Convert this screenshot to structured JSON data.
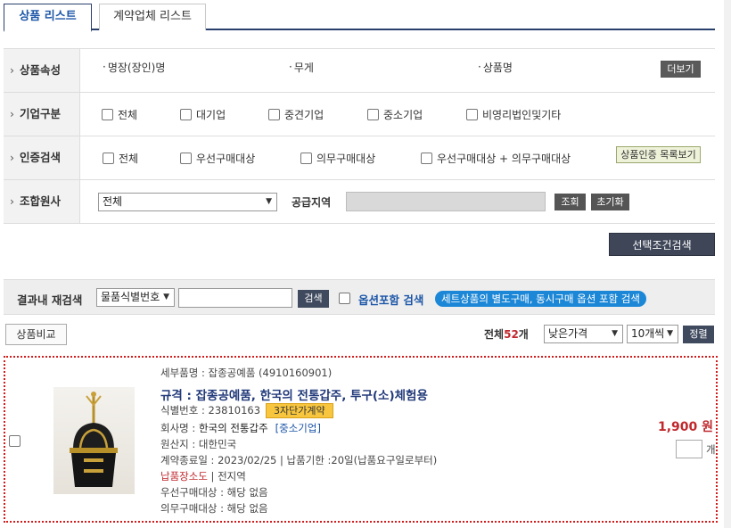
{
  "tabs": [
    {
      "label": "상품 리스트"
    },
    {
      "label": "계약업체 리스트"
    }
  ],
  "filters": {
    "attr": {
      "label": "상품속성",
      "items": [
        "명장(장인)명",
        "무게",
        "상품명"
      ],
      "more_btn": "더보기"
    },
    "company": {
      "label": "기업구분",
      "options": [
        "전체",
        "대기업",
        "중견기업",
        "중소기업",
        "비영리법인및기타"
      ]
    },
    "cert": {
      "label": "인증검색",
      "options": [
        "전체",
        "우선구매대상",
        "의무구매대상",
        "우선구매대상 + 의무구매대상"
      ],
      "list_btn": "상품인증 목록보기"
    },
    "union": {
      "label": "조합원사",
      "select_value": "전체",
      "region_label": "공급지역",
      "search_btn": "조회",
      "reset_btn": "초기화"
    }
  },
  "search_selected_btn": "선택조건검색",
  "research": {
    "label": "결과내 재검색",
    "select_value": "물품식별번호",
    "input_value": "",
    "search_btn": "검색",
    "option_label": "옵션포함 검색",
    "option_note": "세트상품의 별도구매, 동시구매 옵션 포함 검색"
  },
  "list": {
    "compare_btn": "상품비교",
    "total_prefix": "전체",
    "total_count": "52",
    "total_suffix": "개",
    "sort_value": "낮은가격",
    "page_size": "10개씩",
    "sort_btn": "정렬"
  },
  "product": {
    "detail_name": "세부품명 : 잡종공예품 (4910160901)",
    "title": "규격 : 잡종공예품, 한국의 전통갑주, 투구(소)체험용",
    "id_label": "식별번호 : 23810163",
    "badge": "3자단가계약",
    "company_label": "회사명 : ",
    "company_name": "한국의 전통갑주",
    "company_type": "[중소기업]",
    "origin": "원산지 : 대한민국",
    "contract": "계약종료일 : 2023/02/25 | 납품기한 :20일(납품요구일로부터)",
    "delivery_label": "납품장소도",
    "delivery_value": " | 전지역",
    "priority": "우선구매대상 : 해당 없음",
    "mandatory": "의무구매대상 : 해당 없음",
    "price": "1,900 원",
    "qty_value": "",
    "qty_unit": "개"
  }
}
